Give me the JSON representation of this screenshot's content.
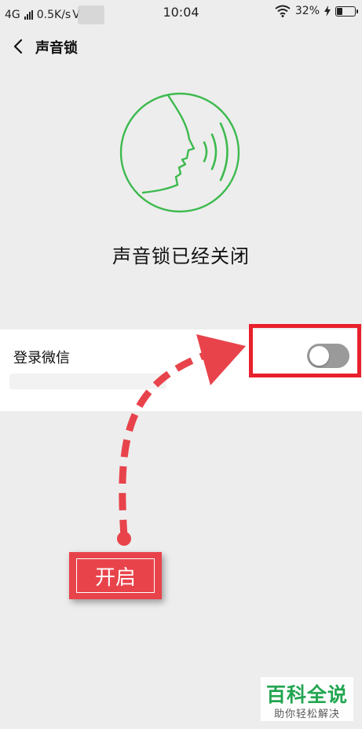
{
  "status_bar": {
    "network": "4G",
    "speed": "0.5K/s",
    "carrier_suffix": "V",
    "time": "10:04",
    "battery_percent": "32%",
    "battery_level": 0.32,
    "icons": [
      "signal-icon",
      "wifi-icon",
      "charging-icon",
      "battery-icon"
    ]
  },
  "nav": {
    "title": "声音锁",
    "back_icon": "chevron-left-icon"
  },
  "hero": {
    "icon": "voice-face-icon",
    "status_text": "声音锁已经关闭"
  },
  "setting": {
    "label": "登录微信",
    "toggle_on": false
  },
  "annotation": {
    "callout_text": "开启",
    "accent_color": "#e8202b"
  },
  "watermark": {
    "main": "百科全说",
    "sub": "助你轻松解决"
  },
  "colors": {
    "background": "#ededed",
    "icon_green": "#3dba4e",
    "toggle_off": "#9a9a9a"
  }
}
